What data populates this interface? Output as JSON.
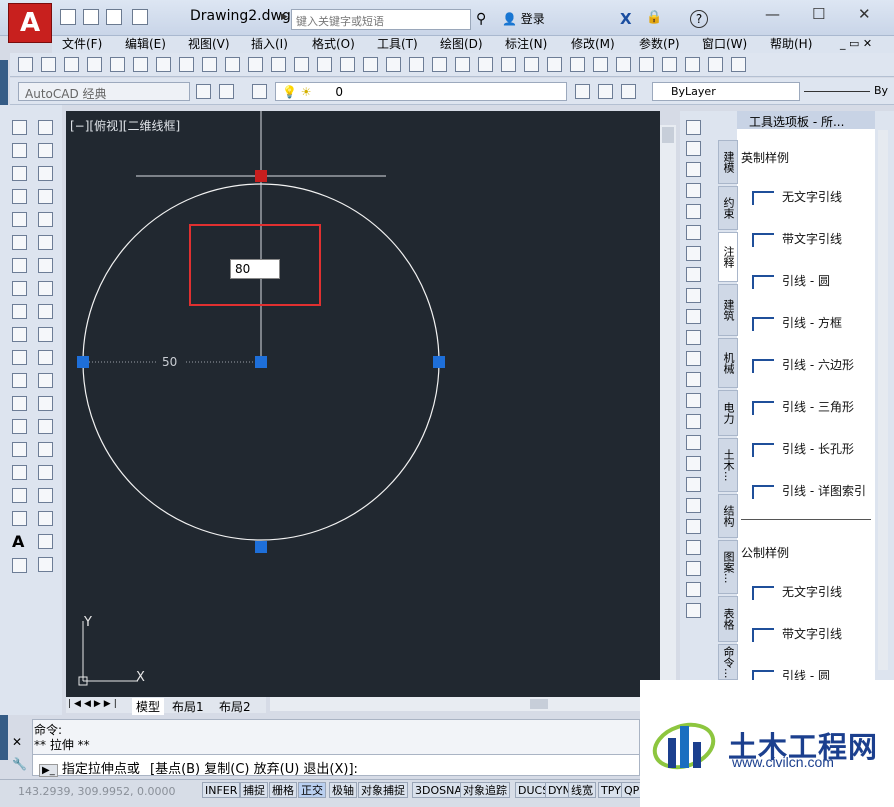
{
  "window": {
    "title": "Drawing2.dwg",
    "search_placeholder": "键入关键字或短语",
    "login_label": "登录",
    "help_label": "?"
  },
  "menu": [
    "文件(F)",
    "编辑(E)",
    "视图(V)",
    "插入(I)",
    "格式(O)",
    "工具(T)",
    "绘图(D)",
    "标注(N)",
    "修改(M)",
    "参数(P)",
    "窗口(W)",
    "帮助(H)"
  ],
  "toolbar": {
    "workspace": "AutoCAD 经典",
    "layer_value": "0",
    "color_value": "ByLayer",
    "linetype_value": "By"
  },
  "viewport": {
    "label": "[−][俯视][二维线框]",
    "dim_radius_label": "50",
    "input_value": "80"
  },
  "layout_tabs": [
    "模型",
    "布局1",
    "布局2"
  ],
  "tool_palette": {
    "title": "工具选项板 - 所...",
    "tabs": [
      "建模",
      "约束",
      "注释",
      "建筑",
      "机械",
      "电力",
      "土木...",
      "结构",
      "图案...",
      "表格",
      "命令..."
    ],
    "sections": [
      {
        "heading": "英制样例",
        "items": [
          "无文字引线",
          "带文字引线",
          "引线 - 圆",
          "引线 - 方框",
          "引线 - 六边形",
          "引线 - 三角形",
          "引线 - 长孔形",
          "引线 - 详图索引"
        ]
      },
      {
        "heading": "公制样例",
        "items": [
          "无文字引线",
          "带文字引线",
          "引线 - 圆"
        ]
      }
    ]
  },
  "command": {
    "line1": "命令:",
    "line2": "** 拉伸 **",
    "prompt": "指定拉伸点或",
    "options": "[基点(B) 复制(C) 放弃(U) 退出(X)]:"
  },
  "status": {
    "coords": "143.2939, 309.9952, 0.0000",
    "buttons": [
      "INFER",
      "捕捉",
      "栅格",
      "正交",
      "极轴",
      "对象捕捉",
      "3DOSNAP",
      "对象追踪",
      "DUCS",
      "DYN",
      "线宽",
      "TPY",
      "QP"
    ]
  },
  "watermark": {
    "brand": "土木工程网",
    "url": "www.civilcn.com"
  },
  "colors": {
    "canvas": "#212830",
    "grip": "#1e6fd9",
    "grip_hot": "#c81e1e",
    "highlight_box": "#e03030",
    "brand": "#1b3f8e"
  }
}
